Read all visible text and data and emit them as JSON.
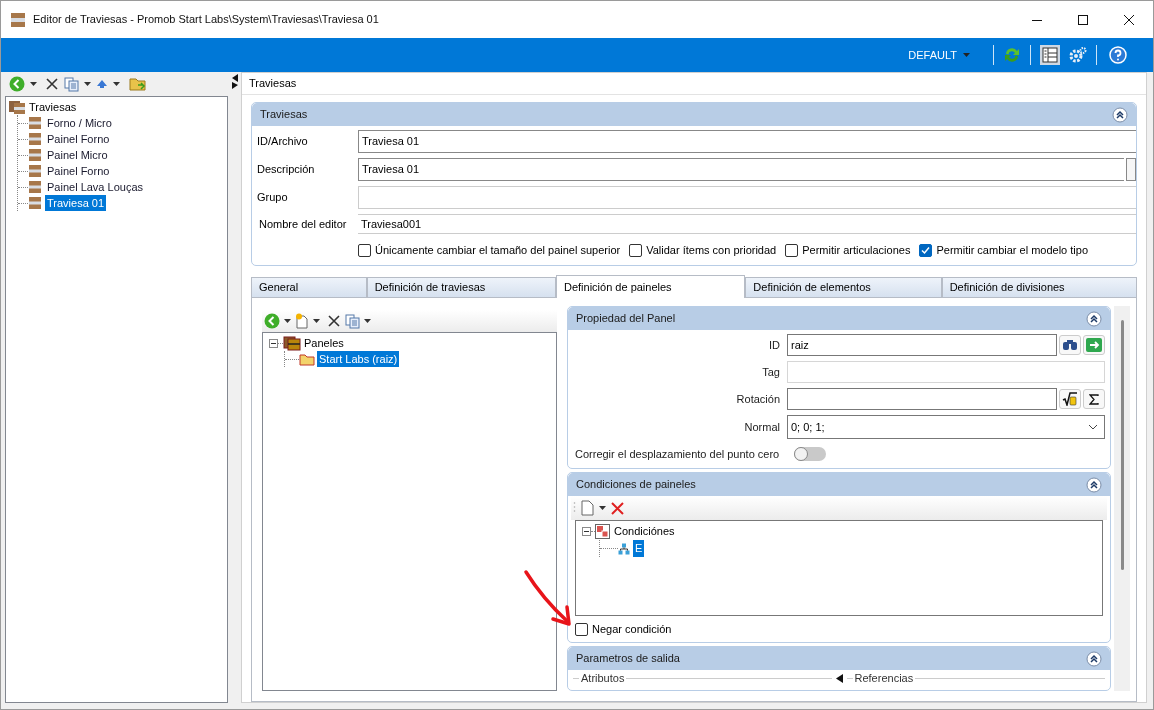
{
  "window": {
    "title": "Editor de Traviesas - Promob Start Labs\\System\\Traviesas\\Traviesa 01"
  },
  "ribbon": {
    "profile": "DEFAULT"
  },
  "left_tree": {
    "label": "Traviesas",
    "children": [
      {
        "label": "Forno / Micro",
        "selected": false
      },
      {
        "label": "Painel Forno",
        "selected": false
      },
      {
        "label": "Painel Micro",
        "selected": false
      },
      {
        "label": "Painel Forno",
        "selected": false
      },
      {
        "label": "Painel Lava Louças",
        "selected": false
      },
      {
        "label": "Traviesa 01",
        "selected": true
      }
    ]
  },
  "header": "Traviesas",
  "traviesas_section": {
    "title": "Traviesas",
    "expanded": true,
    "fields": [
      {
        "label": "ID/Archivo",
        "value": "Traviesa 01",
        "kind": "text"
      },
      {
        "label": "Descripción",
        "value": "Traviesa 01",
        "kind": "button"
      },
      {
        "label": "Grupo",
        "kind": "text"
      },
      {
        "label": "Nombre del editor",
        "value": "Traviesa001",
        "kind": "text"
      }
    ],
    "checkboxes": [
      {
        "label": "Únicamente cambiar el tamaño del painel superior",
        "checked": false
      },
      {
        "label": "Validar ítems con prioridad",
        "checked": false
      },
      {
        "label": "Permitir articulaciones",
        "checked": false
      },
      {
        "label": "Permitir cambiar el modelo tipo",
        "checked": true
      }
    ]
  },
  "tabs": [
    {
      "label": "General",
      "selected": false
    },
    {
      "label": "Definición de traviesas",
      "selected": false
    },
    {
      "label": "Definición de paineles",
      "selected": true
    },
    {
      "label": "Definición de elementos",
      "selected": false
    },
    {
      "label": "Definición de divisiones",
      "selected": false
    }
  ],
  "panels_tree": {
    "label": "Paneles",
    "expanded": true,
    "children": [
      {
        "label": "Start Labs (raiz)",
        "selected": true
      }
    ]
  },
  "panel_properties": {
    "title": "Propiedad del Panel",
    "expanded": true,
    "fields": [
      {
        "label": "ID",
        "value": "raiz",
        "kind": "lookup"
      },
      {
        "label": "Tag",
        "kind": "text"
      },
      {
        "label": "Rotación",
        "kind": "formula"
      },
      {
        "label": "Normal",
        "value": "0; 0; 1;",
        "kind": "dropdown"
      }
    ],
    "toggle": {
      "label": "Corregir el desplazamiento del punto cero",
      "on": false
    }
  },
  "conditions": {
    "title": "Condiciones de paineles",
    "expanded": true,
    "tree": {
      "label": "Condiciónes",
      "expanded": true,
      "children": [
        {
          "label": "E",
          "selected": true
        }
      ]
    },
    "negate": {
      "label": "Negar condición",
      "checked": false
    }
  },
  "output": {
    "title": "Parametros de salida",
    "expanded": true,
    "columns": [
      "Atributos",
      "Referencias"
    ]
  }
}
